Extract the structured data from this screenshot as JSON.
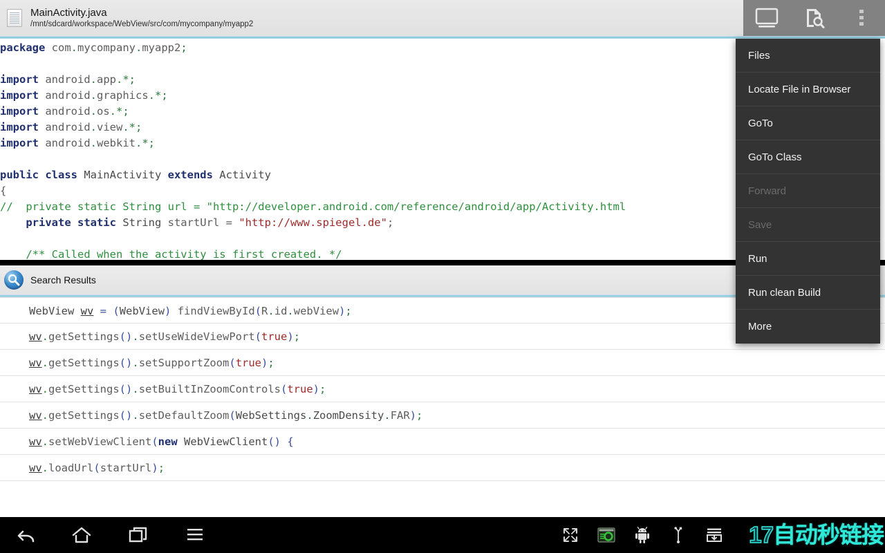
{
  "header": {
    "file_name": "MainActivity.java",
    "file_path": "/mnt/sdcard/workspace/WebView/src/com/mycompany/myapp2",
    "file_icon": "document-icon"
  },
  "toolbar": {
    "buttons": [
      {
        "name": "display-icon",
        "label": "Display"
      },
      {
        "name": "file-search-icon",
        "label": "Search File"
      },
      {
        "name": "overflow-menu-icon",
        "label": "More options"
      }
    ]
  },
  "editor": {
    "language": "java",
    "lines": [
      [
        {
          "t": "package",
          "c": "kw"
        },
        {
          "t": " com",
          "c": "id"
        },
        {
          "t": ".",
          "c": "pun"
        },
        {
          "t": "mycompany",
          "c": "id"
        },
        {
          "t": ".",
          "c": "pun"
        },
        {
          "t": "myapp2",
          "c": "id"
        },
        {
          "t": ";",
          "c": "pun"
        }
      ],
      [],
      [
        {
          "t": "import",
          "c": "kw"
        },
        {
          "t": " android",
          "c": "id"
        },
        {
          "t": ".",
          "c": "pun"
        },
        {
          "t": "app",
          "c": "id"
        },
        {
          "t": ".*;",
          "c": "pun"
        }
      ],
      [
        {
          "t": "import",
          "c": "kw"
        },
        {
          "t": " android",
          "c": "id"
        },
        {
          "t": ".",
          "c": "pun"
        },
        {
          "t": "graphics",
          "c": "id"
        },
        {
          "t": ".*;",
          "c": "pun"
        }
      ],
      [
        {
          "t": "import",
          "c": "kw"
        },
        {
          "t": " android",
          "c": "id"
        },
        {
          "t": ".",
          "c": "pun"
        },
        {
          "t": "os",
          "c": "id"
        },
        {
          "t": ".*;",
          "c": "pun"
        }
      ],
      [
        {
          "t": "import",
          "c": "kw"
        },
        {
          "t": " android",
          "c": "id"
        },
        {
          "t": ".",
          "c": "pun"
        },
        {
          "t": "view",
          "c": "id"
        },
        {
          "t": ".*;",
          "c": "pun"
        }
      ],
      [
        {
          "t": "import",
          "c": "kw"
        },
        {
          "t": " android",
          "c": "id"
        },
        {
          "t": ".",
          "c": "pun"
        },
        {
          "t": "webkit",
          "c": "id"
        },
        {
          "t": ".*;",
          "c": "pun"
        }
      ],
      [],
      [
        {
          "t": "public class",
          "c": "kw"
        },
        {
          "t": " MainActivity ",
          "c": "cls"
        },
        {
          "t": "extends",
          "c": "kw"
        },
        {
          "t": " Activity",
          "c": "cls"
        }
      ],
      [
        {
          "t": "{",
          "c": "id"
        }
      ],
      [
        {
          "t": "//  private static String url = \"http://developer.android.com/reference/android/app/Activity.html",
          "c": "cmt"
        }
      ],
      [
        {
          "t": "    ",
          "c": "id"
        },
        {
          "t": "private static",
          "c": "kw"
        },
        {
          "t": " String ",
          "c": "cls"
        },
        {
          "t": "startUrl ",
          "c": "id"
        },
        {
          "t": "= ",
          "c": "id"
        },
        {
          "t": "\"http://www.spiegel.de\"",
          "c": "str"
        },
        {
          "t": ";",
          "c": "id"
        }
      ],
      [],
      [
        {
          "t": "    /** Called when the activity is first created. */",
          "c": "cmt"
        }
      ]
    ]
  },
  "menu": {
    "items": [
      {
        "label": "Files",
        "name": "menu-item-files",
        "disabled": false
      },
      {
        "label": "Locate File in Browser",
        "name": "menu-item-locate-file-in-browser",
        "disabled": false
      },
      {
        "label": "GoTo",
        "name": "menu-item-goto",
        "disabled": false
      },
      {
        "label": "GoTo Class",
        "name": "menu-item-goto-class",
        "disabled": false
      },
      {
        "label": "Forward",
        "name": "menu-item-forward",
        "disabled": true
      },
      {
        "label": "Save",
        "name": "menu-item-save",
        "disabled": true
      },
      {
        "label": "Run",
        "name": "menu-item-run",
        "disabled": false
      },
      {
        "label": "Run clean Build",
        "name": "menu-item-run-clean-build",
        "disabled": false
      },
      {
        "label": "More",
        "name": "menu-item-more",
        "disabled": false
      }
    ]
  },
  "search_results": {
    "title": "Search Results",
    "icon": "search-icon",
    "query_term": "wv",
    "rows": [
      [
        {
          "t": "WebView ",
          "c": "cls"
        },
        {
          "t": "wv",
          "c": "hit"
        },
        {
          "t": " ",
          "c": "id"
        },
        {
          "t": "=",
          "c": "brk"
        },
        {
          "t": " ",
          "c": "id"
        },
        {
          "t": "(",
          "c": "brk"
        },
        {
          "t": "WebView",
          "c": "cls"
        },
        {
          "t": ")",
          "c": "brk"
        },
        {
          "t": " findViewById",
          "c": "id"
        },
        {
          "t": "(",
          "c": "brk"
        },
        {
          "t": "R",
          "c": "id"
        },
        {
          "t": ".",
          "c": "pun"
        },
        {
          "t": "id",
          "c": "id"
        },
        {
          "t": ".",
          "c": "pun"
        },
        {
          "t": "webView",
          "c": "id"
        },
        {
          "t": ")",
          "c": "brk"
        },
        {
          "t": ";",
          "c": "pun"
        }
      ],
      [
        {
          "t": "wv",
          "c": "hit"
        },
        {
          "t": ".",
          "c": "pun"
        },
        {
          "t": "getSettings",
          "c": "id"
        },
        {
          "t": "()",
          "c": "brk"
        },
        {
          "t": ".",
          "c": "pun"
        },
        {
          "t": "setUseWideViewPort",
          "c": "id"
        },
        {
          "t": "(",
          "c": "brk"
        },
        {
          "t": "true",
          "c": "str"
        },
        {
          "t": ")",
          "c": "brk"
        },
        {
          "t": ";",
          "c": "pun"
        }
      ],
      [
        {
          "t": "wv",
          "c": "hit"
        },
        {
          "t": ".",
          "c": "pun"
        },
        {
          "t": "getSettings",
          "c": "id"
        },
        {
          "t": "()",
          "c": "brk"
        },
        {
          "t": ".",
          "c": "pun"
        },
        {
          "t": "setSupportZoom",
          "c": "id"
        },
        {
          "t": "(",
          "c": "brk"
        },
        {
          "t": "true",
          "c": "str"
        },
        {
          "t": ")",
          "c": "brk"
        },
        {
          "t": ";",
          "c": "pun"
        }
      ],
      [
        {
          "t": "wv",
          "c": "hit"
        },
        {
          "t": ".",
          "c": "pun"
        },
        {
          "t": "getSettings",
          "c": "id"
        },
        {
          "t": "()",
          "c": "brk"
        },
        {
          "t": ".",
          "c": "pun"
        },
        {
          "t": "setBuiltInZoomControls",
          "c": "id"
        },
        {
          "t": "(",
          "c": "brk"
        },
        {
          "t": "true",
          "c": "str"
        },
        {
          "t": ")",
          "c": "brk"
        },
        {
          "t": ";",
          "c": "pun"
        }
      ],
      [
        {
          "t": "wv",
          "c": "hit"
        },
        {
          "t": ".",
          "c": "pun"
        },
        {
          "t": "getSettings",
          "c": "id"
        },
        {
          "t": "()",
          "c": "brk"
        },
        {
          "t": ".",
          "c": "pun"
        },
        {
          "t": "setDefaultZoom",
          "c": "id"
        },
        {
          "t": "(",
          "c": "brk"
        },
        {
          "t": "WebSettings",
          "c": "cls"
        },
        {
          "t": ".",
          "c": "pun"
        },
        {
          "t": "ZoomDensity",
          "c": "cls"
        },
        {
          "t": ".",
          "c": "pun"
        },
        {
          "t": "FAR",
          "c": "id"
        },
        {
          "t": ")",
          "c": "brk"
        },
        {
          "t": ";",
          "c": "pun"
        }
      ],
      [
        {
          "t": "wv",
          "c": "hit"
        },
        {
          "t": ".",
          "c": "pun"
        },
        {
          "t": "setWebViewClient",
          "c": "id"
        },
        {
          "t": "(",
          "c": "brk"
        },
        {
          "t": "new",
          "c": "kw"
        },
        {
          "t": " WebViewClient",
          "c": "cls"
        },
        {
          "t": "()",
          "c": "brk"
        },
        {
          "t": " ",
          "c": "id"
        },
        {
          "t": "{",
          "c": "brk"
        }
      ],
      [
        {
          "t": "wv",
          "c": "hit"
        },
        {
          "t": ".",
          "c": "pun"
        },
        {
          "t": "loadUrl",
          "c": "id"
        },
        {
          "t": "(",
          "c": "brk"
        },
        {
          "t": "startUrl",
          "c": "id"
        },
        {
          "t": ")",
          "c": "brk"
        },
        {
          "t": ";",
          "c": "pun"
        }
      ]
    ]
  },
  "navbar": {
    "left_buttons": [
      {
        "name": "back-icon",
        "label": "Back"
      },
      {
        "name": "home-icon",
        "label": "Home"
      },
      {
        "name": "recents-icon",
        "label": "Recent apps"
      },
      {
        "name": "menu-icon",
        "label": "Menu"
      }
    ],
    "status_icons": [
      {
        "name": "fullscreen-icon",
        "label": "Fullscreen"
      },
      {
        "name": "screen-recorder-icon",
        "label": "Screen recorder"
      },
      {
        "name": "android-robot-icon",
        "label": "Android"
      },
      {
        "name": "usb-icon",
        "label": "USB connected"
      },
      {
        "name": "download-icon",
        "label": "Download"
      }
    ],
    "watermark": {
      "number": "17",
      "text": "自动秒链接"
    }
  },
  "colors": {
    "header_bg": "#e4e4e4",
    "accent_cyan": "#7fc3d8",
    "toolbar_bg": "#828282",
    "menu_bg": "#333333",
    "menu_disabled_text": "#6b6b6b",
    "navbar_bg": "#000000",
    "watermark": "#2fe8d8",
    "keyword": "#203070",
    "string": "#9e2b2b",
    "comment": "#2f8f3f"
  }
}
